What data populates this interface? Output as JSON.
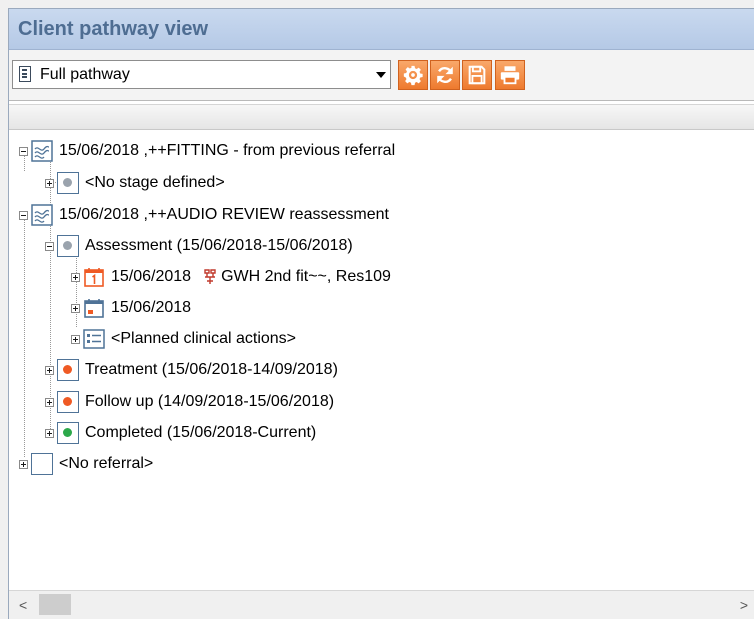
{
  "window": {
    "title": "Client pathway view"
  },
  "toolbar": {
    "view_select": {
      "value": "Full pathway"
    },
    "buttons": [
      "settings-icon",
      "refresh-icon",
      "save-icon",
      "print-icon"
    ]
  },
  "tree": {
    "referral1": "15/06/2018 ,++FITTING - from previous referral",
    "referral1_child": "<No stage defined>",
    "referral2": "15/06/2018 ,++AUDIO REVIEW reassessment",
    "assessment": "Assessment (15/06/2018-15/06/2018)",
    "appt1_date": "15/06/2018",
    "appt1_detail": "GWH 2nd fit~~, Res109",
    "appt2_date": "15/06/2018",
    "planned": "<Planned clinical actions>",
    "treatment": "Treatment (15/06/2018-14/09/2018)",
    "followup": "Follow up (14/09/2018-15/06/2018)",
    "completed": "Completed (15/06/2018-Current)",
    "no_referral": "<No referral>"
  },
  "colors": {
    "accent": "#ee7a2e",
    "stage_orange": "#ef5a24",
    "stage_green": "#2ca84a",
    "stage_grey": "#9aa3ad"
  },
  "scrollbar": {
    "left_arrow": "<",
    "right_arrow": ">"
  }
}
